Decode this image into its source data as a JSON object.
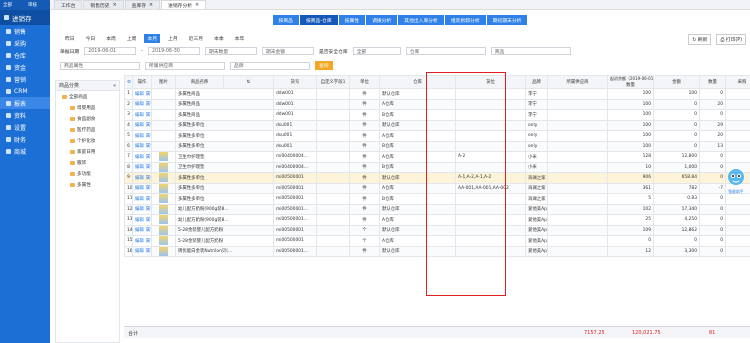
{
  "sidebar": {
    "top": [
      "全部",
      "审核"
    ],
    "active": "进销存",
    "items": [
      {
        "label": "销售",
        "selected": false
      },
      {
        "label": "采购",
        "selected": false
      },
      {
        "label": "仓库",
        "selected": false
      },
      {
        "label": "资金",
        "selected": false
      },
      {
        "label": "营销",
        "selected": false
      },
      {
        "label": "CRM",
        "selected": false
      },
      {
        "label": "报表",
        "selected": true
      },
      {
        "label": "资料",
        "selected": false
      },
      {
        "label": "设置",
        "selected": false
      },
      {
        "label": "财务",
        "selected": false
      },
      {
        "label": "商城",
        "selected": false
      }
    ]
  },
  "page_tabs": [
    "工作台",
    "销售历史",
    "查库存",
    "进销存分析"
  ],
  "subnav": [
    {
      "label": "按商品",
      "active": false
    },
    {
      "label": "按商品-仓库",
      "active": true
    },
    {
      "label": "按属性",
      "active": false
    },
    {
      "label": "调拨分析",
      "active": false
    },
    {
      "label": "其他出入库分析",
      "active": false
    },
    {
      "label": "组装拆卸分析",
      "active": false
    },
    {
      "label": "期初期末分析",
      "active": false
    }
  ],
  "quick_dates": [
    "昨日",
    "今日",
    "本周",
    "上周",
    "本月",
    "上月",
    "近三月",
    "本季",
    "本年"
  ],
  "filters": {
    "date_label": "单据日期",
    "date_from": "2019-06-01",
    "date_to": "2019-06-30",
    "end_qty": "期末数量",
    "end_amount": "期末金额",
    "safety_label": "是否安全仓库",
    "safety_value": "全部",
    "warehouse": "仓库",
    "product": "商品",
    "product_attr": "商品属性",
    "attr_value": "所属供应商",
    "brand": "品牌",
    "query": "查询",
    "refresh": "刷新",
    "print": "打印(P)"
  },
  "tree": {
    "title": "商品分类",
    "items": [
      "全部商品",
      "母婴用品",
      "食品副食",
      "医疗药品",
      "个护化妆",
      "家庭日用",
      "服饰",
      "多功能",
      "多属性"
    ]
  },
  "table": {
    "headers": [
      "",
      "操作",
      "图片",
      "商品名称",
      "",
      "货号",
      "自定义字段1",
      "单位",
      "仓库",
      "货位",
      "品牌",
      "所属供应商",
      "数量",
      "金额",
      "数量",
      "采购"
    ],
    "group_header": "起初余额（2019-06-01之前）",
    "rows": [
      [
        "1",
        "多属性商品",
        "ddw001",
        "件",
        "默认仓库",
        "",
        "李宁",
        "",
        "100",
        "100",
        "0"
      ],
      [
        "2",
        "多属性商品",
        "ddw001",
        "件",
        "A仓库",
        "",
        "李宁",
        "",
        "100",
        "0",
        "20"
      ],
      [
        "3",
        "多属性商品",
        "ddw001",
        "件",
        "B仓库",
        "",
        "李宁",
        "",
        "100",
        "0",
        "0"
      ],
      [
        "4",
        "多属性多单位",
        "dsu001",
        "件",
        "默认仓库",
        "",
        "only",
        "",
        "100",
        "0",
        "29"
      ],
      [
        "5",
        "多属性多单位",
        "dsu001",
        "件",
        "A仓库",
        "",
        "only",
        "",
        "100",
        "0",
        "20"
      ],
      [
        "6",
        "多属性多单位",
        "dsu001",
        "件",
        "B仓库",
        "",
        "only",
        "",
        "100",
        "0",
        "13"
      ],
      [
        "7",
        "卫生巾护理垫",
        "mi00400004...",
        "件",
        "A仓库",
        "A-2",
        "小米",
        "",
        "128",
        "12,800",
        "0"
      ],
      [
        "8",
        "卫生巾护理垫",
        "mi00400004...",
        "件",
        "B仓库",
        "",
        "小米",
        "",
        "10",
        "1,000",
        "0"
      ],
      [
        "9",
        "多属性多单位",
        "mi00500001",
        "件",
        "默认仓库",
        "A-1,A-2,A-1,A-2",
        "海澜之家",
        "",
        "906",
        "658.84",
        "0"
      ],
      [
        "10",
        "多属性多单位",
        "mi00500001",
        "件",
        "A仓库",
        "AA-001,AA-001,AA-002",
        "海澜之家",
        "",
        "361",
        "782",
        "-7"
      ],
      [
        "11",
        "多属性多单位",
        "mi00500001",
        "件",
        "B仓库",
        "",
        "海澜之家",
        "",
        "5",
        "0.83",
        "0"
      ],
      [
        "12",
        "幼儿配方奶粉(900g装8...",
        "mi00500001...",
        "件",
        "默认仓库",
        "",
        "爱他美Aptamil",
        "",
        "102",
        "17,340",
        "0"
      ],
      [
        "13",
        "幼儿配方奶粉(900g装8...",
        "mi00500001...",
        "件",
        "A仓库",
        "",
        "爱他美Aptamil",
        "",
        "25",
        "4,250",
        "0"
      ],
      [
        "14",
        "5-28金装婴儿配方奶粉",
        "mi00500001",
        "个",
        "默认仓库",
        "",
        "爱他美Aptamil",
        "",
        "109",
        "12,862",
        "0"
      ],
      [
        "15",
        "5-28金装婴儿配方奶粉",
        "mi00500001",
        "个",
        "A仓库",
        "",
        "爱他美Aptamil",
        "",
        "0",
        "0",
        "0"
      ],
      [
        "16",
        "牌优能白金装Nutrilon贝(...",
        "mi00500001...",
        "件",
        "默认仓库",
        "",
        "爱他美Aptamil",
        "",
        "12",
        "3,300",
        "0"
      ]
    ],
    "op_edit": "编辑",
    "op_attr": "属性",
    "footer_label": "合计",
    "footer_values": [
      "7157.25",
      "120,021.75",
      "81"
    ]
  },
  "mascot_label": "智能助手"
}
